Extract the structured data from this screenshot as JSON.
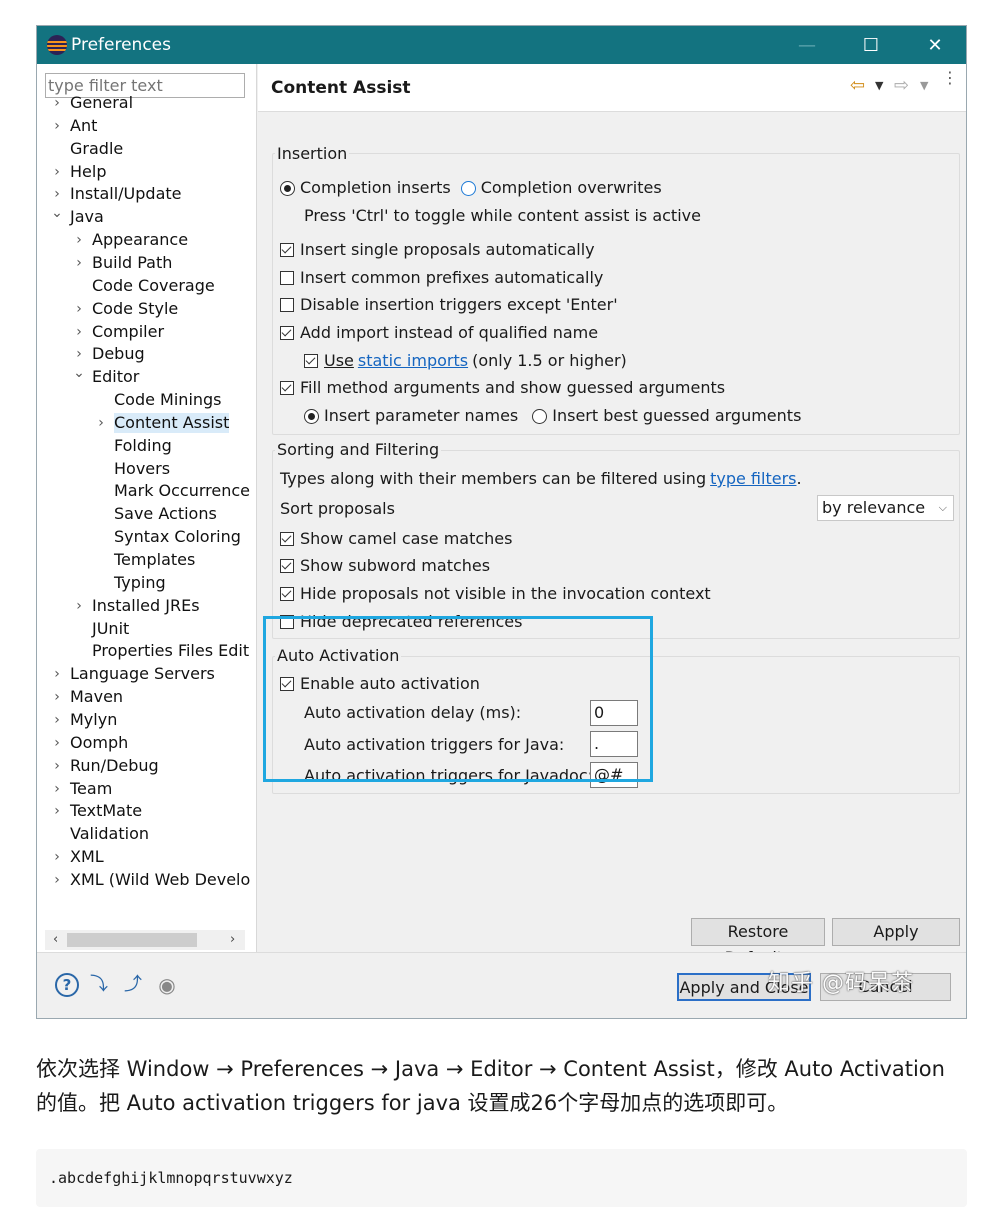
{
  "window": {
    "title": "Preferences",
    "min": "—",
    "max": "☐",
    "close": "✕"
  },
  "filter": {
    "placeholder": "type filter text"
  },
  "tree": [
    {
      "label": "General"
    },
    {
      "label": "Ant"
    },
    {
      "label": "Gradle"
    },
    {
      "label": "Help"
    },
    {
      "label": "Install/Update"
    },
    {
      "label": "Java"
    },
    {
      "label": "Appearance"
    },
    {
      "label": "Build Path"
    },
    {
      "label": "Code Coverage"
    },
    {
      "label": "Code Style"
    },
    {
      "label": "Compiler"
    },
    {
      "label": "Debug"
    },
    {
      "label": "Editor"
    },
    {
      "label": "Code Minings"
    },
    {
      "label": "Content Assist"
    },
    {
      "label": "Folding"
    },
    {
      "label": "Hovers"
    },
    {
      "label": "Mark Occurrence"
    },
    {
      "label": "Save Actions"
    },
    {
      "label": "Syntax Coloring"
    },
    {
      "label": "Templates"
    },
    {
      "label": "Typing"
    },
    {
      "label": "Installed JREs"
    },
    {
      "label": "JUnit"
    },
    {
      "label": "Properties Files Edit"
    },
    {
      "label": "Language Servers"
    },
    {
      "label": "Maven"
    },
    {
      "label": "Mylyn"
    },
    {
      "label": "Oomph"
    },
    {
      "label": "Run/Debug"
    },
    {
      "label": "Team"
    },
    {
      "label": "TextMate"
    },
    {
      "label": "Validation"
    },
    {
      "label": "XML"
    },
    {
      "label": "XML (Wild Web Develo"
    }
  ],
  "page": {
    "title": "Content Assist"
  },
  "insertion": {
    "title": "Insertion",
    "completion_inserts": "Completion inserts",
    "completion_overwrites": "Completion overwrites",
    "toggle_hint": "Press 'Ctrl' to toggle while content assist is active",
    "single_proposals": "Insert single proposals automatically",
    "common_prefixes": "Insert common prefixes automatically",
    "disable_triggers": "Disable insertion triggers except 'Enter'",
    "add_import": "Add import instead of qualified name",
    "use": "Use",
    "static_imports": "static imports",
    "only_15": "(only 1.5 or higher)",
    "fill_method": "Fill method arguments and show guessed arguments",
    "param_names": "Insert parameter names",
    "best_guessed": "Insert best guessed arguments"
  },
  "sorting": {
    "title": "Sorting and Filtering",
    "types_text": "Types along with their members can be filtered using",
    "type_filters": "type filters",
    "period": ".",
    "sort_proposals": "Sort proposals",
    "sort_value": "by relevance",
    "camel_case": "Show camel case matches",
    "subword": "Show subword matches",
    "hide_not_visible": "Hide proposals not visible in the invocation context",
    "hide_deprecated": "Hide deprecated references"
  },
  "auto": {
    "title": "Auto Activation",
    "enable": "Enable auto activation",
    "delay_label": "Auto activation delay (ms):",
    "delay_value": "0",
    "java_label": "Auto activation triggers for Java:",
    "java_value": ".",
    "javadoc_label": "Auto activation triggers for Javadoc:",
    "javadoc_value": "@#"
  },
  "buttons": {
    "restore_defaults": "Restore Defaults",
    "apply": "Apply",
    "apply_close": "Apply and Close",
    "cancel": "Cancel"
  },
  "watermark": "知乎 @码呆茶",
  "description": "依次选择 Window → Preferences → Java → Editor → Content Assist，修改 Auto Activation 的值。把 Auto activation triggers for java 设置成26个字母加点的选项即可。",
  "code": ".abcdefghijklmnopqrstuvwxyz",
  "colors": {
    "titlebar": "#137380",
    "highlight": "#1fa7e0",
    "link": "#1565c0"
  }
}
